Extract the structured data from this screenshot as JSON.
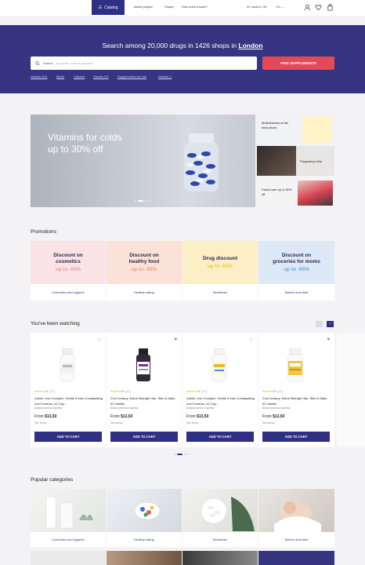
{
  "header": {
    "catalog": "Catalog",
    "nav": [
      "About project",
      "Shops",
      "How does it work?"
    ],
    "location": "London, UK",
    "language": "En"
  },
  "hero": {
    "title_prefix": "Search among 20,000 drugs in 1426 shops in",
    "city": "London",
    "search_label": "Search",
    "search_placeholder": "by name, code or purpose",
    "find_button": "FIND SUPPLEMENTS",
    "quick_links": [
      "Vitamin B12",
      "Biotin",
      "Calcium",
      "Vitamin D3",
      "Supplements for hair",
      "Vitamin C"
    ]
  },
  "banners": {
    "main_title_1": "Vitamins for colds",
    "main_title_2": "up to 30% off",
    "side": [
      "Multivitamins at the best prices",
      "Pregnancy help",
      "Facial care up to 50% off"
    ]
  },
  "promotions": {
    "title": "Promotions",
    "items": [
      {
        "line1": "Discount on",
        "line2": "cosmetics",
        "discount": "up to -65%",
        "label": "Cosmetics and hygiene",
        "bg": "#f9e3e6",
        "accent": "#f29aa3"
      },
      {
        "line1": "Discount on",
        "line2": "healthy food",
        "discount": "up to -55%",
        "label": "Healthy eating",
        "bg": "#fbe2d8",
        "accent": "#f39a7c"
      },
      {
        "line1": "Drug discount",
        "line2": "",
        "discount": "up to -65%",
        "label": "Medicines",
        "bg": "#fcefc5",
        "accent": "#f2c744"
      },
      {
        "line1": "Discount on",
        "line2": "groceries for moms",
        "discount": "up to -65%",
        "label": "Mother and child",
        "bg": "#dde9f6",
        "accent": "#6aa6dc"
      }
    ]
  },
  "watching": {
    "title": "You've been watching",
    "products": [
      {
        "rating_count": "(17)",
        "name": "Zahler, Iron Complex, Gentle & Non-Constipating Iron Formula, 10 Cap...",
        "brand": "Balkanpharma-Dupnitsa",
        "price_from": "From",
        "price": "$13,50",
        "see_shops": "See shops",
        "add": "ADD TO CART",
        "fav": false
      },
      {
        "rating_count": "(17)",
        "name": "21st Century, Extra Strength Hair, Skin & Nails, 90 Tablets",
        "brand": "Balkanpharma-Dupnitsa",
        "price_from": "From",
        "price": "$13,50",
        "see_shops": "See shops",
        "add": "ADD TO CART",
        "fav": true
      },
      {
        "rating_count": "(17)",
        "name": "Zahler, Iron Complex, Gentle & Non-Constipating Iron Formula, 10 Cap...",
        "brand": "Balkanpharma-Dupnitsa",
        "price_from": "From",
        "price": "$13,50",
        "see_shops": "See shops",
        "add": "ADD TO CART",
        "fav": false
      },
      {
        "rating_count": "(17)",
        "name": "21st Century, Extra Strength Hair, Skin & Nails, 90 Tablets",
        "brand": "Balkanpharma-Dupnitsa",
        "price_from": "From",
        "price": "$13,50",
        "see_shops": "See shops",
        "add": "ADD TO CART",
        "fav": true
      }
    ],
    "rating_stars": "★★★★",
    "rating_empty": "★"
  },
  "popular": {
    "title": "Popular categories",
    "items": [
      "Cosmetics and hygiene",
      "Healthy eating",
      "Medicines",
      "Mother and child"
    ]
  }
}
